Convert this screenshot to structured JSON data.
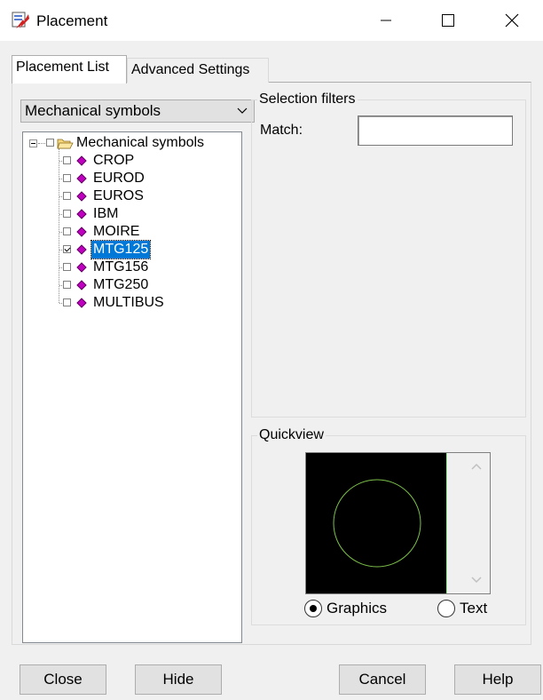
{
  "window": {
    "title": "Placement"
  },
  "tabs": [
    {
      "label": "Placement List",
      "active": true
    },
    {
      "label": "Advanced Settings",
      "active": false
    }
  ],
  "category": {
    "selected": "Mechanical symbols"
  },
  "tree": {
    "root": {
      "label": "Mechanical symbols",
      "expanded": true,
      "checked": false
    },
    "items": [
      {
        "label": "CROP",
        "checked": false,
        "selected": false
      },
      {
        "label": "EUROD",
        "checked": false,
        "selected": false
      },
      {
        "label": "EUROS",
        "checked": false,
        "selected": false
      },
      {
        "label": "IBM",
        "checked": false,
        "selected": false
      },
      {
        "label": "MOIRE",
        "checked": false,
        "selected": false
      },
      {
        "label": "MTG125",
        "checked": true,
        "selected": true
      },
      {
        "label": "MTG156",
        "checked": false,
        "selected": false
      },
      {
        "label": "MTG250",
        "checked": false,
        "selected": false
      },
      {
        "label": "MULTIBUS",
        "checked": false,
        "selected": false
      }
    ]
  },
  "selection_filters": {
    "title": "Selection filters",
    "match_label": "Match:",
    "match_value": ""
  },
  "quickview": {
    "title": "Quickview",
    "options": [
      {
        "label": "Graphics",
        "selected": true
      },
      {
        "label": "Text",
        "selected": false
      }
    ],
    "colors": {
      "background": "#000000",
      "symbol_stroke": "#7cc04a"
    }
  },
  "buttons": {
    "close": "Close",
    "hide": "Hide",
    "cancel": "Cancel",
    "help": "Help"
  },
  "colors": {
    "selection": "#0078d7",
    "symbol_icon": "#c000c0"
  }
}
